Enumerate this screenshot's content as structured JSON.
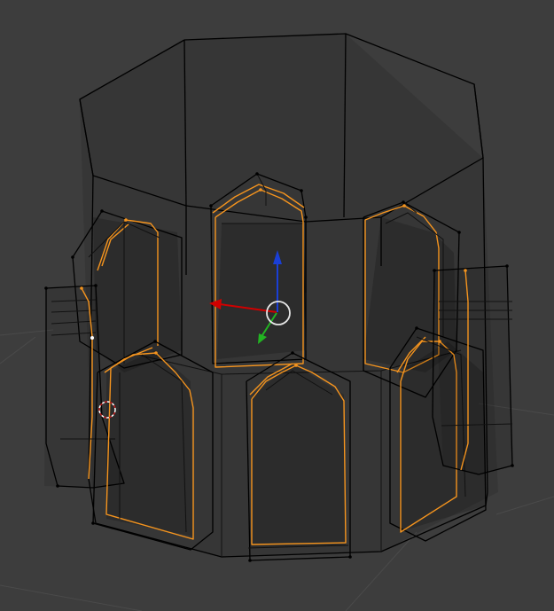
{
  "viewport": {
    "background": "#3d3d3d",
    "grid_color": "#4a4a4a",
    "wire_color": "#000000",
    "selection_color": "#f5941e",
    "active_vertex_color": "#ffffff"
  },
  "gizmo": {
    "x_axis_color": "#d00000",
    "y_axis_color": "#22b422",
    "z_axis_color": "#1a3fd6",
    "pivot_color": "#e6e6e6"
  },
  "cursor_3d": {
    "ring_colors": [
      "#ffffff",
      "#c41e1e"
    ]
  }
}
